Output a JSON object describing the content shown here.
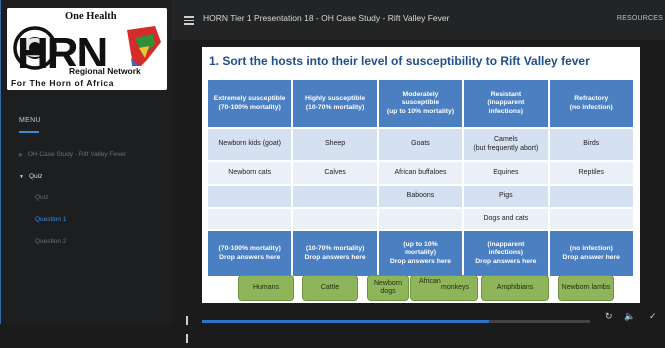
{
  "logo": {
    "line1": "One Health",
    "letters": "HRN",
    "line2": "Regional Network",
    "line3": "For The Horn of Africa"
  },
  "sidebar": {
    "menu_label": "MENU",
    "items": [
      {
        "label": "OH Case Study - Rift Valley Fever",
        "state": "collapsed"
      },
      {
        "label": "Quiz",
        "state": "expanded"
      },
      {
        "label": "Quiz",
        "state": "normal"
      },
      {
        "label": "Question 1",
        "state": "active"
      },
      {
        "label": "Question 2",
        "state": "normal"
      }
    ]
  },
  "topbar": {
    "title": "HORN Tier 1 Presentation 18 - OH Case Study - Rift Valley Fever",
    "resources": "RESOURCES"
  },
  "slide": {
    "title": "1. Sort the hosts into their level of susceptibility to Rift Valley fever",
    "headers": [
      [
        "Extremely susceptible",
        "(70-100% mortality)"
      ],
      [
        "Highly susceptible",
        "(10-70% mortality)"
      ],
      [
        "Moderately",
        "susceptible",
        "(up to 10% mortality)"
      ],
      [
        "Resistant",
        "(inapparent",
        "infections)"
      ],
      [
        "Refractory",
        "(no infection)"
      ]
    ],
    "rows": [
      [
        "Newborn kids (goat)",
        "Sheep",
        "Goats",
        "Camels\n(but frequently abort)",
        "Birds"
      ],
      [
        "Newborn cats",
        "Calves",
        "African buffaloes",
        "Equines",
        "Reptiles"
      ],
      [
        "",
        "",
        "Baboons",
        "Pigs",
        ""
      ],
      [
        "",
        "",
        "",
        "Dogs and cats",
        ""
      ]
    ],
    "drop_zones": [
      [
        "(70-100% mortality)",
        "Drop answers here"
      ],
      [
        "(10-70% mortality)",
        "Drop answers here"
      ],
      [
        "(up to 10%",
        "mortality)",
        "Drop answers here"
      ],
      [
        "(inapparent",
        "infections)",
        "Drop answers here"
      ],
      [
        "(no infection)",
        "Drop answer here"
      ]
    ],
    "chips": [
      {
        "text": "Humans"
      },
      {
        "text": "Cattle"
      },
      {
        "text": "Newborn dogs"
      },
      {
        "text_left": "African",
        "text_right": "monkeys"
      },
      {
        "text": "Amphibians"
      },
      {
        "text": "Newborn lambs"
      }
    ]
  },
  "player": {
    "progress": 0.74,
    "pause_icon": "pause-icon",
    "replay_icon": "replay-icon",
    "volume_icon": "volume-icon",
    "check_icon": "check-icon"
  },
  "colors": {
    "header_blue": "#4a7fc2",
    "row_light": "#eaf0f8",
    "row_mid": "#d5e0f0",
    "chip_green": "#8fb55b",
    "title_blue": "#1f4e8c",
    "accent_blue": "#2e74c9"
  }
}
